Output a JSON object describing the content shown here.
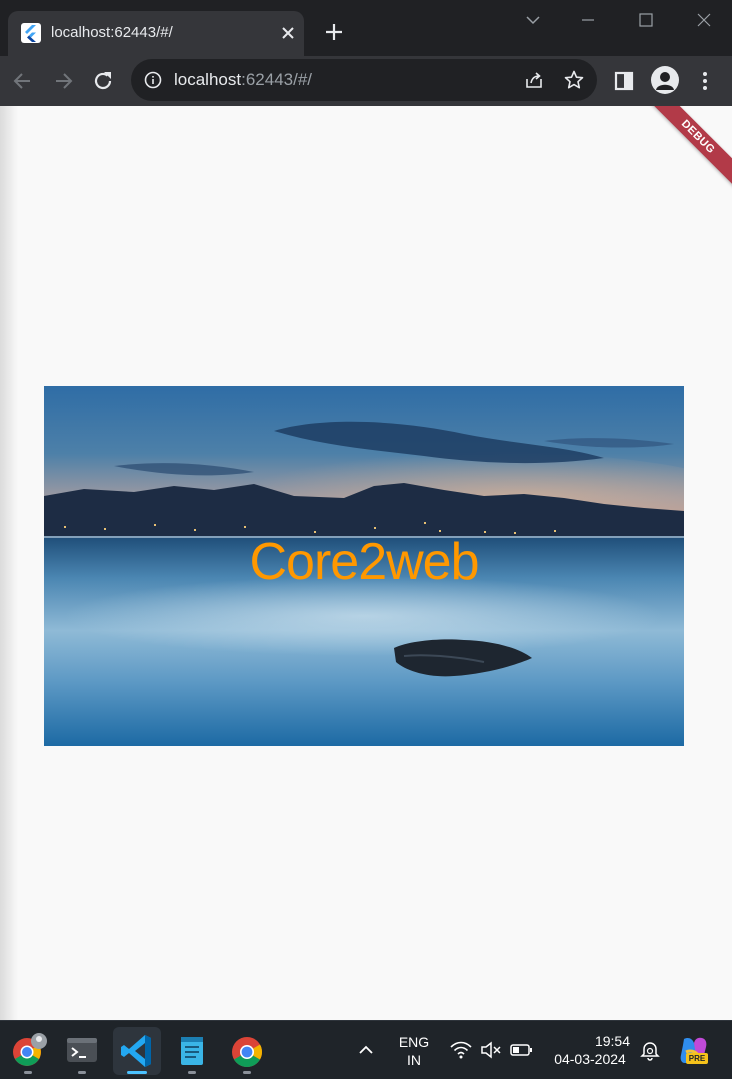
{
  "browser": {
    "tab": {
      "title": "localhost:62443/#/"
    },
    "omnibox": {
      "host": "localhost",
      "rest": ":62443/#/"
    }
  },
  "page": {
    "debug_banner": "DEBUG",
    "hero_text": "Core2web",
    "colors": {
      "hero_text": "#ff9800",
      "debug_banner": "#b23a48",
      "background": "#f9f9f9"
    }
  },
  "taskbar": {
    "apps": [
      {
        "name": "chrome-profile-icon"
      },
      {
        "name": "terminal-icon"
      },
      {
        "name": "vscode-icon"
      },
      {
        "name": "notepad-icon"
      },
      {
        "name": "chrome-icon"
      }
    ],
    "language": {
      "line1": "ENG",
      "line2": "IN"
    },
    "clock": {
      "time": "19:54",
      "date": "04-03-2024"
    },
    "copilot_badge": "PRE"
  }
}
